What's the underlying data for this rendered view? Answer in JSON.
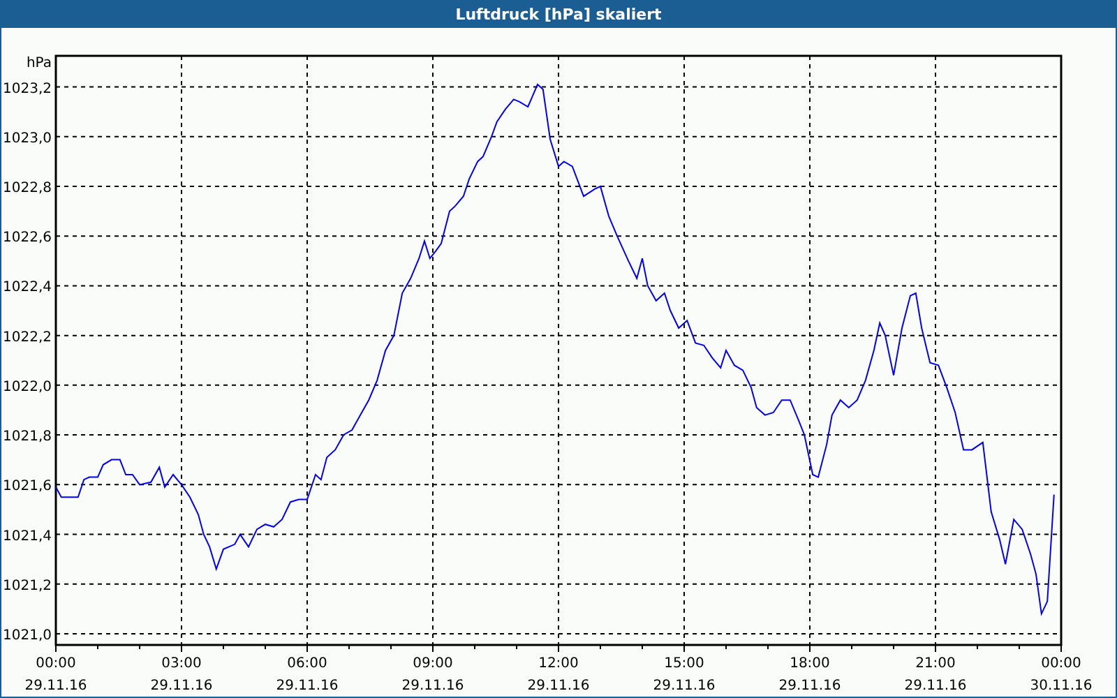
{
  "window": {
    "title": "Luftdruck [hPa] skaliert"
  },
  "chart": {
    "axis_dates": [
      "29.11.16",
      "29.11.16",
      "29.11.16",
      "29.11.16",
      "29.11.16",
      "29.11.16",
      "29.11.16",
      "29.11.16",
      "30.11.16"
    ],
    "chart_data": {
      "type": "line",
      "grid": true,
      "ylabel": "hPa",
      "xlim": [
        0,
        24
      ],
      "ylim": [
        1020.955,
        1023.325
      ],
      "xticks": [
        {
          "value": 0,
          "label": "00:00"
        },
        {
          "value": 3,
          "label": "03:00"
        },
        {
          "value": 6,
          "label": "06:00"
        },
        {
          "value": 9,
          "label": "09:00"
        },
        {
          "value": 12,
          "label": "12:00"
        },
        {
          "value": 15,
          "label": "15:00"
        },
        {
          "value": 18,
          "label": "18:00"
        },
        {
          "value": 21,
          "label": "21:00"
        },
        {
          "value": 24,
          "label": "00:00"
        }
      ],
      "yticks": [
        {
          "value": 1021.0,
          "label": "1021,0"
        },
        {
          "value": 1021.2,
          "label": "1021,2"
        },
        {
          "value": 1021.4,
          "label": "1021,4"
        },
        {
          "value": 1021.6,
          "label": "1021,6"
        },
        {
          "value": 1021.8,
          "label": "1021,8"
        },
        {
          "value": 1022.0,
          "label": "1022,0"
        },
        {
          "value": 1022.2,
          "label": "1022,2"
        },
        {
          "value": 1022.4,
          "label": "1022,4"
        },
        {
          "value": 1022.6,
          "label": "1022,6"
        },
        {
          "value": 1022.8,
          "label": "1022,8"
        },
        {
          "value": 1023.0,
          "label": "1023,0"
        },
        {
          "value": 1023.2,
          "label": "1023,2"
        }
      ],
      "x": [
        0,
        0.13,
        0.53,
        0.67,
        0.8,
        1.0,
        1.13,
        1.33,
        1.53,
        1.67,
        1.83,
        2.0,
        2.27,
        2.47,
        2.6,
        2.8,
        3.0,
        3.2,
        3.4,
        3.53,
        3.67,
        3.83,
        4.0,
        4.27,
        4.4,
        4.6,
        4.8,
        5.0,
        5.2,
        5.4,
        5.6,
        5.8,
        6.0,
        6.2,
        6.33,
        6.47,
        6.67,
        6.87,
        7.07,
        7.27,
        7.47,
        7.67,
        7.87,
        8.07,
        8.27,
        8.47,
        8.67,
        8.8,
        8.93,
        9.07,
        9.2,
        9.4,
        9.53,
        9.73,
        9.87,
        10.07,
        10.2,
        10.4,
        10.53,
        10.73,
        10.93,
        11.07,
        11.27,
        11.5,
        11.63,
        11.8,
        12.0,
        12.13,
        12.33,
        12.6,
        12.87,
        13.0,
        13.2,
        13.4,
        13.67,
        13.87,
        14.0,
        14.13,
        14.33,
        14.53,
        14.67,
        14.87,
        15.07,
        15.27,
        15.47,
        15.67,
        15.87,
        16.0,
        16.2,
        16.4,
        16.6,
        16.73,
        16.93,
        17.13,
        17.33,
        17.53,
        17.73,
        17.87,
        18.07,
        18.2,
        18.4,
        18.53,
        18.73,
        18.93,
        19.13,
        19.33,
        19.53,
        19.67,
        19.8,
        20.0,
        20.2,
        20.4,
        20.53,
        20.67,
        20.87,
        21.07,
        21.27,
        21.47,
        21.67,
        21.87,
        22.13,
        22.33,
        22.53,
        22.67,
        22.87,
        23.07,
        23.27,
        23.4,
        23.53,
        23.67,
        23.83
      ],
      "series": [
        {
          "color": "#0000ff",
          "values": [
            1021.59,
            1021.55,
            1021.55,
            1021.62,
            1021.63,
            1021.63,
            1021.68,
            1021.7,
            1021.7,
            1021.64,
            1021.64,
            1021.6,
            1021.61,
            1021.67,
            1021.59,
            1021.64,
            1021.6,
            1021.55,
            1021.48,
            1021.4,
            1021.35,
            1021.26,
            1021.34,
            1021.36,
            1021.4,
            1021.35,
            1021.42,
            1021.44,
            1021.43,
            1021.46,
            1021.53,
            1021.54,
            1021.54,
            1021.64,
            1021.62,
            1021.71,
            1021.74,
            1021.8,
            1021.82,
            1021.88,
            1021.94,
            1022.02,
            1022.14,
            1022.2,
            1022.37,
            1022.43,
            1022.51,
            1022.58,
            1022.51,
            1022.54,
            1022.57,
            1022.7,
            1022.72,
            1022.76,
            1022.83,
            1022.9,
            1022.92,
            1023.0,
            1023.06,
            1023.11,
            1023.15,
            1023.14,
            1023.12,
            1023.21,
            1023.19,
            1022.99,
            1022.88,
            1022.9,
            1022.88,
            1022.76,
            1022.79,
            1022.8,
            1022.68,
            1022.6,
            1022.5,
            1022.43,
            1022.51,
            1022.4,
            1022.34,
            1022.37,
            1022.3,
            1022.23,
            1022.26,
            1022.17,
            1022.16,
            1022.11,
            1022.07,
            1022.14,
            1022.08,
            1022.06,
            1021.99,
            1021.91,
            1021.88,
            1021.89,
            1021.94,
            1021.94,
            1021.86,
            1021.8,
            1021.64,
            1021.63,
            1021.76,
            1021.88,
            1021.94,
            1021.91,
            1021.94,
            1022.02,
            1022.14,
            1022.25,
            1022.2,
            1022.04,
            1022.23,
            1022.36,
            1022.37,
            1022.23,
            1022.09,
            1022.08,
            1021.99,
            1021.89,
            1021.74,
            1021.74,
            1021.77,
            1021.49,
            1021.38,
            1021.28,
            1021.46,
            1021.42,
            1021.32,
            1021.24,
            1021.08,
            1021.13,
            1021.56
          ]
        }
      ]
    }
  }
}
